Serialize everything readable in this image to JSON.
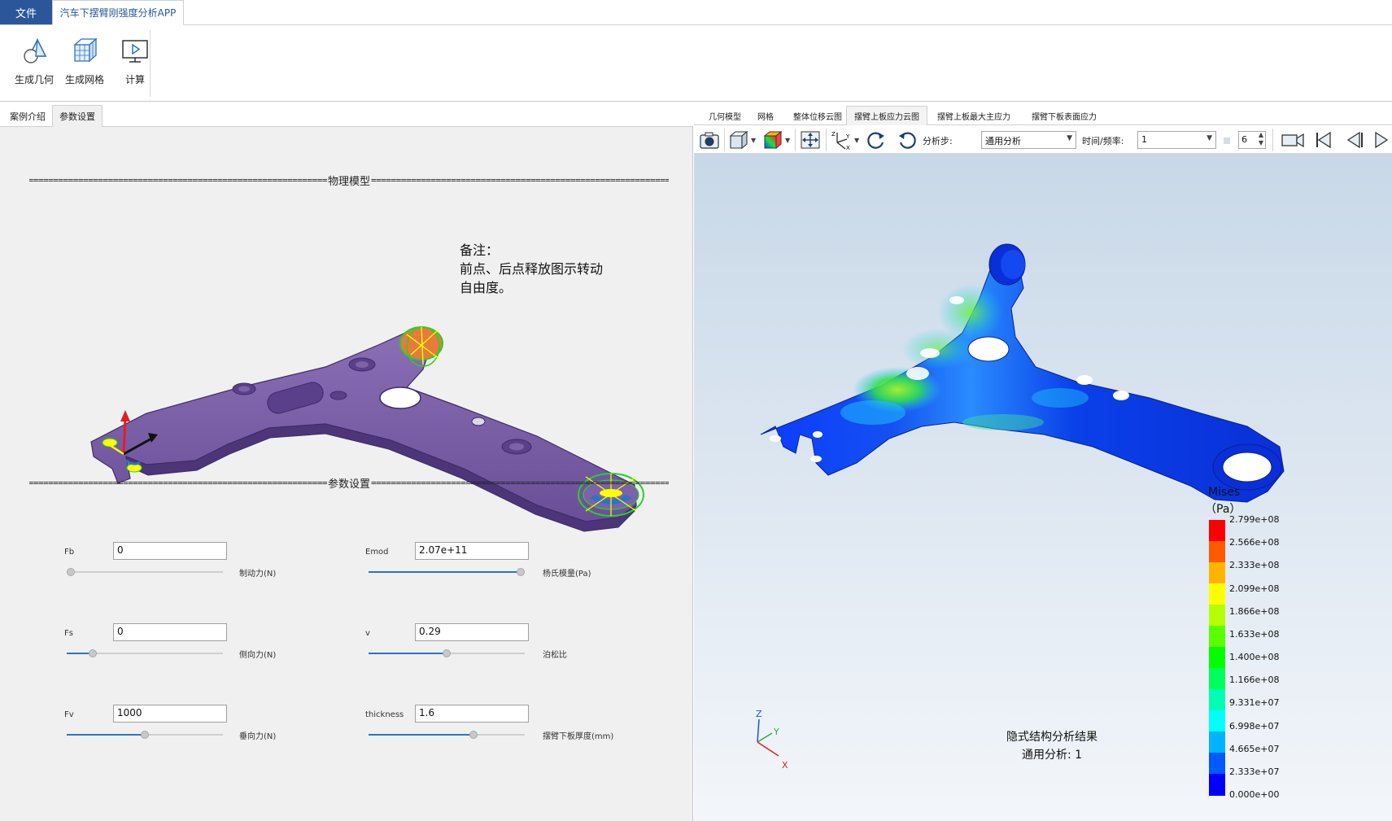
{
  "ribbon": {
    "file_tab": "文件",
    "app_tab": "汽车下摆臂刚强度分析APP",
    "buttons": {
      "geometry": "生成几何",
      "mesh": "生成网格",
      "compute": "计算"
    }
  },
  "left_tabs": {
    "intro": "案例介绍",
    "params": "参数设置"
  },
  "sections": {
    "physical_model": "物理模型",
    "parameters": "参数设置",
    "eq_run": "===================================================================="
  },
  "note": {
    "line1": "备注：",
    "line2": "前点、后点释放图示转动",
    "line3": "自由度。"
  },
  "params": {
    "fb": {
      "label": "Fb",
      "value": "0",
      "unit": "制动力(N)",
      "slider": 0.0
    },
    "fs": {
      "label": "Fs",
      "value": "0",
      "unit": "侧向力(N)",
      "slider": 0.15
    },
    "fv": {
      "label": "Fv",
      "value": "1000",
      "unit": "垂向力(N)",
      "slider": 0.5
    },
    "emod": {
      "label": "Emod",
      "value": "2.07e+11",
      "unit": "杨氏模量(Pa)",
      "slider": 1.0
    },
    "v": {
      "label": "v",
      "value": "0.29",
      "unit": "泊松比",
      "slider": 0.5
    },
    "thickness": {
      "label": "thickness",
      "value": "1.6",
      "unit": "摆臂下板厚度(mm)",
      "slider": 0.68
    }
  },
  "right_tabs": {
    "geom": "几何模型",
    "mesh": "网格",
    "disp": "整体位移云图",
    "upper_stress": "摆臂上板应力云图",
    "upper_principal": "摆臂上板最大主应力",
    "lower_surface": "摆臂下板表面应力"
  },
  "toolbar": {
    "step_label": "分析步:",
    "step_value": "通用分析",
    "time_label": "时间/频率:",
    "time_value": "1",
    "frame_value": "6"
  },
  "legend": {
    "title": "Mises",
    "unit": "（Pa）",
    "labels": [
      "2.799e+08",
      "2.566e+08",
      "2.333e+08",
      "2.099e+08",
      "1.866e+08",
      "1.633e+08",
      "1.400e+08",
      "1.166e+08",
      "9.331e+07",
      "6.998e+07",
      "4.665e+07",
      "2.333e+07",
      "0.000e+00"
    ],
    "colors": [
      "#ff0000",
      "#ff5a00",
      "#ffb400",
      "#ffff00",
      "#b4ff00",
      "#5aff00",
      "#00ff00",
      "#00ff5a",
      "#00ffb4",
      "#00ffff",
      "#00b4ff",
      "#005aff",
      "#0000ff"
    ]
  },
  "result": {
    "line1": "隐式结构分析结果",
    "line2": "通用分析: 1"
  },
  "triad": {
    "x": "X",
    "y": "Y",
    "z": "Z"
  }
}
